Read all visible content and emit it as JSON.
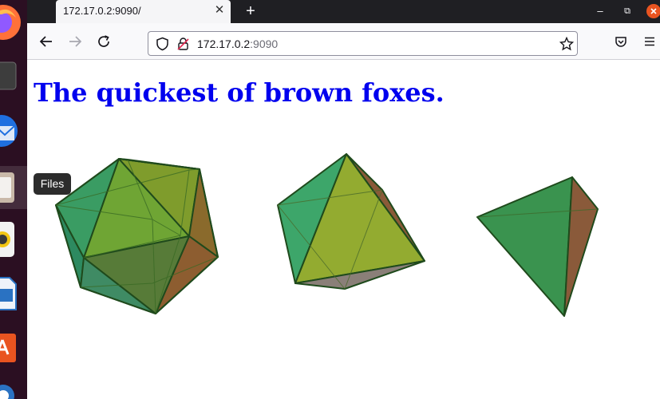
{
  "dock": {
    "items": [
      "firefox-icon",
      "terminal-icon",
      "thunderbird-icon",
      "files-icon",
      "rhythmbox-icon",
      "writer-icon",
      "software-icon",
      "help-icon"
    ],
    "tooltip": "Files"
  },
  "browser": {
    "tab_title": "172.17.0.2:9090/",
    "url_host": "172.17.0.2",
    "url_port": ":9090",
    "accent": "#e95420"
  },
  "page": {
    "heading": "The quickest of brown foxes.",
    "heading_color": "#0000ee",
    "shapes": [
      "icosahedron",
      "octahedron",
      "tetrahedron"
    ]
  }
}
